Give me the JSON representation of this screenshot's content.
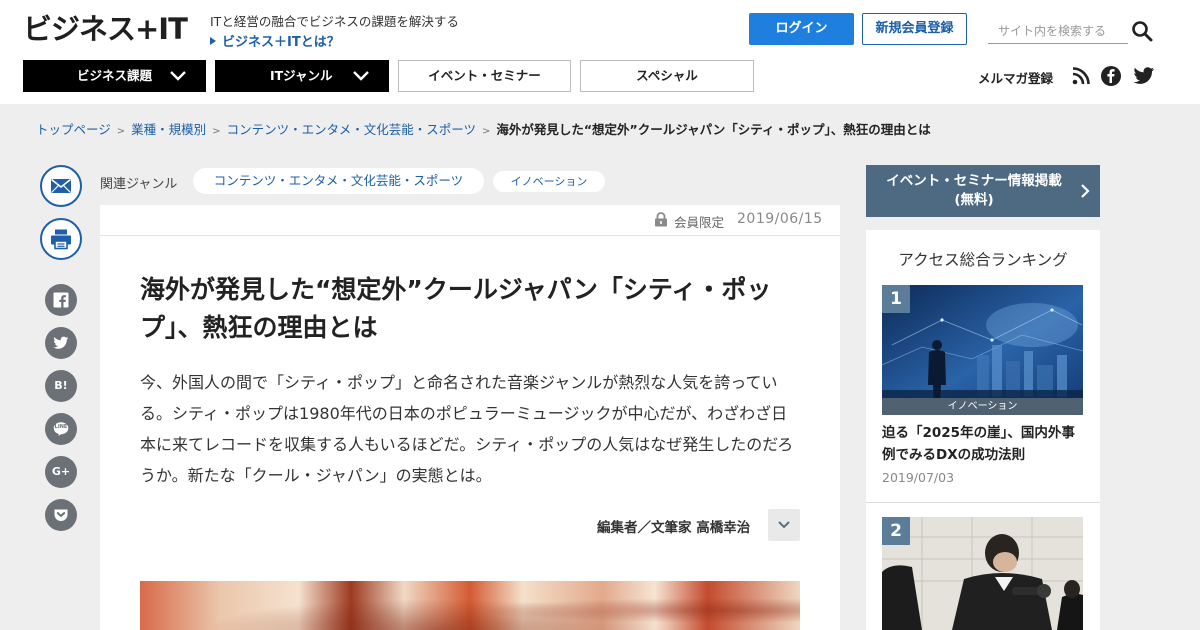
{
  "header": {
    "logo": "ビジネス+IT",
    "tagline": "ITと経営の融合でビジネスの課題を解決する",
    "about_link": "ビジネス＋ITとは？",
    "login_label": "ログイン",
    "register_label": "新規会員登録",
    "search_placeholder": "サイト内を検索する",
    "nav": {
      "business_topics": "ビジネス課題",
      "it_genre": "ITジャンル",
      "events": "イベント・セミナー",
      "special": "スペシャル"
    },
    "mailmag_label": "メルマガ登録"
  },
  "breadcrumb": {
    "items": [
      "トップページ",
      "業種・規模別",
      "コンテンツ・エンタメ・文化芸能・スポーツ"
    ],
    "separator": ">",
    "current": "海外が発見した“想定外”クールジャパン「シティ・ポップ」、熱狂の理由とは"
  },
  "share": {
    "hatena_label": "B!",
    "line_label": "LINE",
    "gplus_label": "G+"
  },
  "genre": {
    "label": "関連ジャンル",
    "tags": [
      "コンテンツ・エンタメ・文化芸能・スポーツ",
      "イノベーション"
    ]
  },
  "article": {
    "members_only": "会員限定",
    "date": "2019/06/15",
    "title": "海外が発見した“想定外”クールジャパン「シティ・ポップ」、熱狂の理由とは",
    "lead": "今、外国人の間で「シティ・ポップ」と命名された音楽ジャンルが熱烈な人気を誇っている。シティ・ポップは1980年代の日本のポピュラーミュージックが中心だが、わざわざ日本に来てレコードを収集する人もいるほどだ。シティ・ポップの人気はなぜ発生したのだろうか。新たな「クール・ジャパン」の実態とは。",
    "author": "編集者／文筆家 高橋幸治"
  },
  "sidebar": {
    "event_banner_line1": "イベント・セミナー情報掲載",
    "event_banner_line2": "(無料)",
    "ranking_title": "アクセス総合ランキング",
    "ranking": [
      {
        "rank": "1",
        "category": "イノベーション",
        "title": "迫る「2025年の崖」、国内外事例でみるDXの成功法則",
        "date": "2019/07/03"
      },
      {
        "rank": "2"
      }
    ]
  },
  "colors": {
    "accent_blue": "#1d5fa8",
    "login_blue": "#1e7fdf",
    "banner_slate": "#4d6a82",
    "rank_badge": "#5b7d99"
  }
}
